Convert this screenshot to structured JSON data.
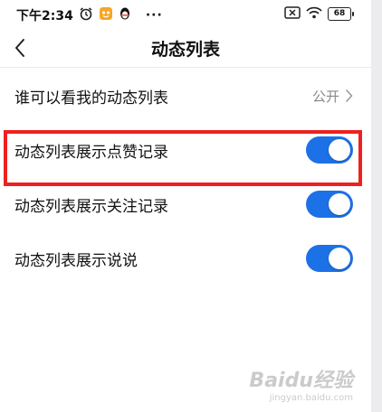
{
  "status_bar": {
    "time": "下午2:34",
    "icons": [
      "alarm-icon",
      "app-icon",
      "qq-penguin-icon"
    ],
    "more": "···",
    "battery": "68"
  },
  "header": {
    "title": "动态列表"
  },
  "rows": [
    {
      "label": "谁可以看我的动态列表",
      "value": "公开"
    },
    {
      "label": "动态列表展示点赞记录",
      "toggle_on": true
    },
    {
      "label": "动态列表展示关注记录",
      "toggle_on": true
    },
    {
      "label": "动态列表展示说说",
      "toggle_on": true
    }
  ],
  "colors": {
    "toggle_on": "#1d71e6",
    "highlight_box": "#ee2121"
  },
  "watermark": {
    "main": "Baidu经验",
    "sub": "jingyan.baidu.com"
  }
}
